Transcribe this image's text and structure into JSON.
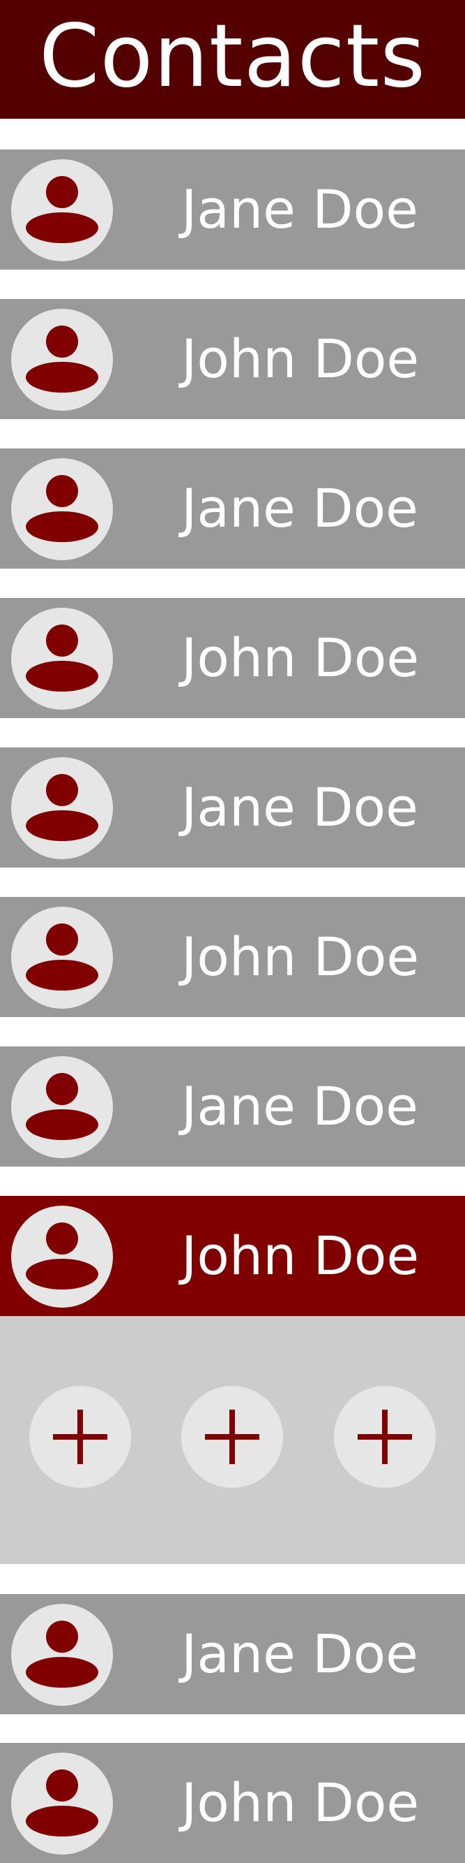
{
  "header": {
    "title": "Contacts"
  },
  "contacts": [
    {
      "name": "Jane Doe",
      "selected": false
    },
    {
      "name": "John Doe",
      "selected": false
    },
    {
      "name": "Jane Doe",
      "selected": false
    },
    {
      "name": "John Doe",
      "selected": false
    },
    {
      "name": "Jane Doe",
      "selected": false
    },
    {
      "name": "John Doe",
      "selected": false
    },
    {
      "name": "Jane Doe",
      "selected": false
    },
    {
      "name": "John Doe",
      "selected": true
    },
    {
      "name": "Jane Doe",
      "selected": false
    },
    {
      "name": "John Doe",
      "selected": false
    }
  ],
  "expanded_actions": [
    {
      "icon": "plus-icon"
    },
    {
      "icon": "plus-icon"
    },
    {
      "icon": "plus-icon"
    }
  ],
  "colors": {
    "header_bg": "#550000",
    "row_bg": "#999999",
    "selected_row_bg": "#800000",
    "panel_bg": "#cccccc",
    "circle_bg": "#e6e6e6",
    "icon": "#800000",
    "text": "#ffffff"
  },
  "icons": {
    "avatar": "person-icon",
    "action": "plus-icon"
  }
}
